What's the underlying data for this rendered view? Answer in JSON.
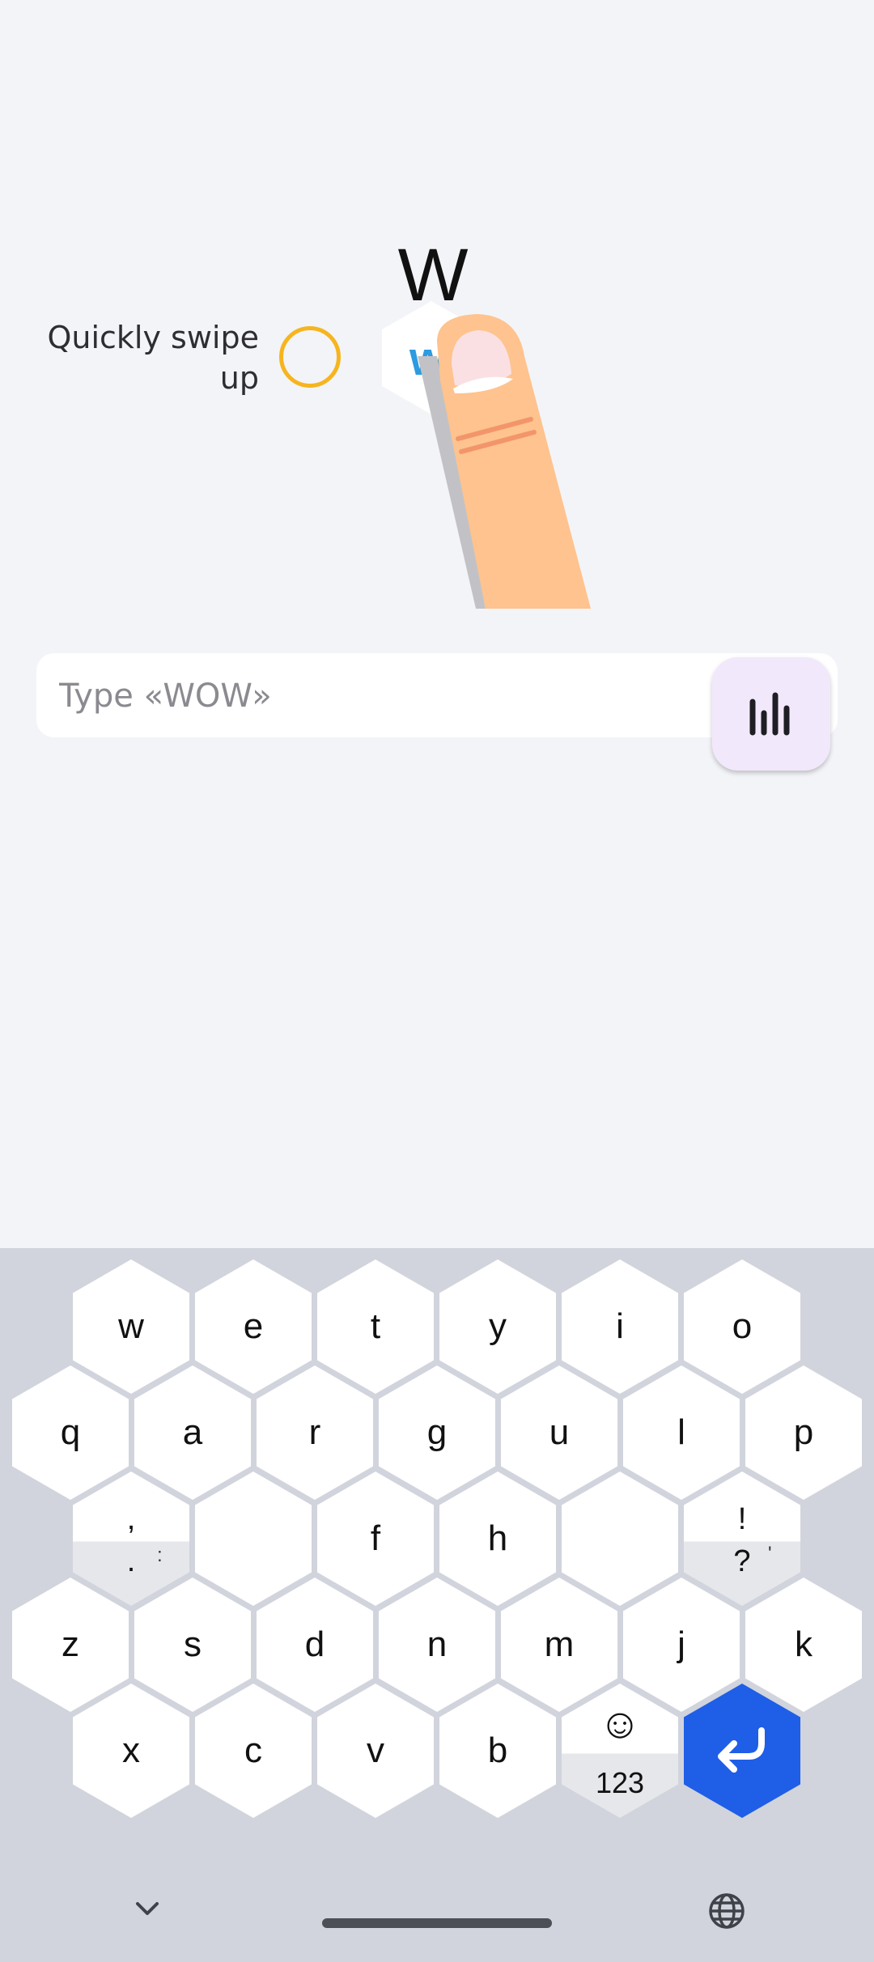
{
  "tutorial": {
    "instruction": "Quickly swipe up",
    "demo_letter": "W",
    "demo_key_letter": "w"
  },
  "input": {
    "placeholder": "Type «WOW»",
    "value": ""
  },
  "voice_button": {
    "icon": "audio-bars-icon"
  },
  "keyboard": {
    "rows": {
      "row1": [
        "w",
        "e",
        "t",
        "y",
        "i",
        "o"
      ],
      "row2": [
        "q",
        "a",
        "r",
        "g",
        "u",
        "l",
        "p"
      ],
      "row3": [
        "",
        "",
        "f",
        "h",
        "",
        ""
      ],
      "row4": [
        "z",
        "s",
        "d",
        "n",
        "m",
        "j",
        "k"
      ],
      "row5": [
        "x",
        "c",
        "v",
        "b",
        "",
        ""
      ]
    },
    "punct_left": {
      "top": ",",
      "bottom": ".",
      "side": ":"
    },
    "punct_right": {
      "top": "!",
      "bottom": "?",
      "side": "'"
    },
    "emoji_key": {
      "emoji": "☺",
      "label": "123"
    },
    "enter_icon": "enter-arrow-icon"
  },
  "nav": {
    "left_icon": "chevron-down-icon",
    "right_icon": "globe-icon"
  },
  "colors": {
    "background": "#f3f4f8",
    "keyboard_bg": "#d1d4dc",
    "enter_key": "#1f5ee6",
    "target_ring": "#f6b51e",
    "voice_button": "#f2e8fb"
  }
}
